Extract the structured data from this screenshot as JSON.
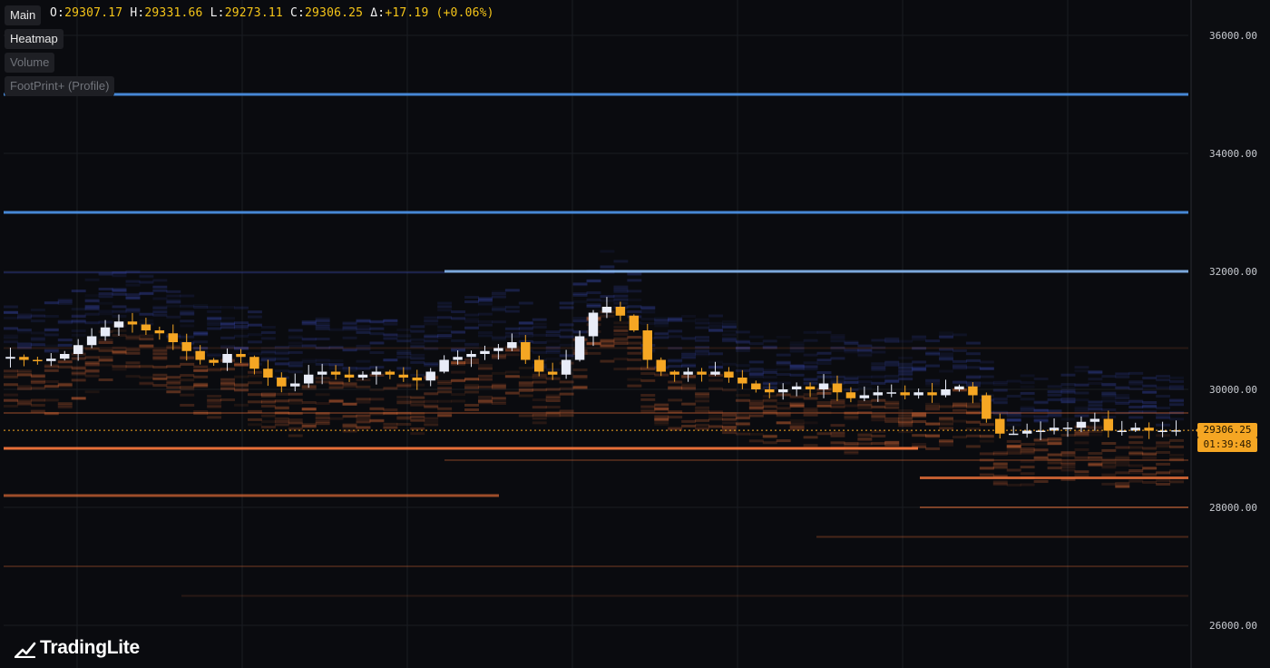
{
  "ohlc_bar": {
    "o_key": "O:",
    "o_val": "29307.17",
    "h_key": "H:",
    "h_val": "29331.66",
    "l_key": "L:",
    "l_val": "29273.11",
    "c_key": "C:",
    "c_val": "29306.25",
    "d_key": "Δ:",
    "d_val": "+17.19 (+0.06%)"
  },
  "layers": {
    "main": "Main",
    "heatmap": "Heatmap",
    "volume": "Volume",
    "footprint": "FootPrint+ (Profile)"
  },
  "price_axis": {
    "labels": [
      "36000.00",
      "34000.00",
      "32000.00",
      "30000.00",
      "28000.00",
      "26000.00"
    ],
    "current_price": "29306.25",
    "countdown": "01:39:48"
  },
  "brand": {
    "name": "TradingLite"
  },
  "colors": {
    "background": "#0a0b0f",
    "up_candle": "#e8ecf8",
    "down_candle": "#f5a623",
    "bid_heat": "#ff7a3d",
    "ask_heat": "#3d4fbf",
    "wall_line": "#4a8ee0"
  },
  "chart_data": {
    "type": "candlestick",
    "y_axis_ticks": [
      36000,
      34000,
      32000,
      30000,
      28000,
      26000
    ],
    "last_price": 29306.25,
    "ohlc": {
      "open": 29307.17,
      "high": 29331.66,
      "low": 29273.11,
      "close": 29306.25
    },
    "walls": [
      {
        "price": 35000,
        "side": "ask"
      },
      {
        "price": 33000,
        "side": "ask"
      },
      {
        "price": 32000,
        "side": "ask"
      },
      {
        "price": 29000,
        "side": "bid"
      },
      {
        "price": 28200,
        "side": "bid"
      },
      {
        "price": 28500,
        "side": "bid"
      }
    ],
    "close_series": [
      30550,
      30500,
      30480,
      30520,
      30600,
      30750,
      30900,
      31050,
      31150,
      31100,
      31000,
      30950,
      30800,
      30650,
      30500,
      30450,
      30600,
      30550,
      30350,
      30200,
      30050,
      30100,
      30250,
      30300,
      30250,
      30200,
      30250,
      30300,
      30250,
      30200,
      30150,
      30300,
      30500,
      30550,
      30600,
      30650,
      30700,
      30800,
      30500,
      30300,
      30250,
      30500,
      30900,
      31300,
      31400,
      31250,
      31000,
      30500,
      30300,
      30250,
      30300,
      30250,
      30300,
      30200,
      30100,
      30000,
      29950,
      30000,
      30050,
      30000,
      30100,
      29950,
      29850,
      29900,
      29950,
      29950,
      29900,
      29950,
      29900,
      30000,
      30050,
      29900,
      29500,
      29250,
      29250,
      29300,
      29300,
      29350,
      29350,
      29450,
      29500,
      29300,
      29300,
      29350,
      29300,
      29300,
      29306
    ]
  }
}
